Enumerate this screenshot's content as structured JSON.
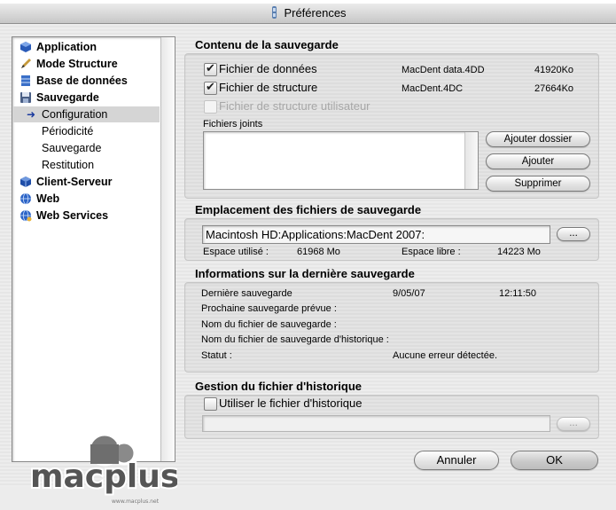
{
  "window": {
    "title": "Préférences"
  },
  "sidebar": {
    "items": [
      {
        "label": "Application",
        "icon": "app-cube-icon",
        "level": 0
      },
      {
        "label": "Mode Structure",
        "icon": "pencil-icon",
        "level": 0
      },
      {
        "label": "Base de données",
        "icon": "database-icon",
        "level": 0
      },
      {
        "label": "Sauvegarde",
        "icon": "floppy-icon",
        "level": 0
      },
      {
        "label": "Configuration",
        "icon": "arrow-right-icon",
        "level": 1,
        "selected": true
      },
      {
        "label": "Périodicité",
        "level": 1
      },
      {
        "label": "Sauvegarde",
        "level": 1
      },
      {
        "label": "Restitution",
        "level": 1
      },
      {
        "label": "Client-Serveur",
        "icon": "network-cube-icon",
        "level": 0
      },
      {
        "label": "Web",
        "icon": "globe-icon",
        "level": 0
      },
      {
        "label": "Web Services",
        "icon": "web-services-icon",
        "level": 0
      }
    ]
  },
  "backup_content": {
    "title": "Contenu de la sauvegarde",
    "files": [
      {
        "label": "Fichier de données",
        "checked": true,
        "disabled": false,
        "filename": "MacDent data.4DD",
        "size": "41920Ko"
      },
      {
        "label": "Fichier de structure",
        "checked": true,
        "disabled": false,
        "filename": "MacDent.4DC",
        "size": "27664Ko"
      },
      {
        "label": "Fichier de structure utilisateur",
        "checked": false,
        "disabled": true,
        "filename": "",
        "size": ""
      }
    ],
    "attached_label": "Fichiers joints",
    "buttons": {
      "add_folder": "Ajouter dossier",
      "add": "Ajouter",
      "remove": "Supprimer"
    }
  },
  "location": {
    "title": "Emplacement des fichiers de sauvegarde",
    "path": "Macintosh HD:Applications:MacDent 2007:",
    "browse": "...",
    "used_label": "Espace utilisé :",
    "used_value": "61968 Mo",
    "free_label": "Espace libre :",
    "free_value": "14223 Mo"
  },
  "last_backup": {
    "title": "Informations sur la dernière sauvegarde",
    "last_label": "Dernière sauvegarde",
    "last_date": "9/05/07",
    "last_time": "12:11:50",
    "next_label": "Prochaine sauvegarde prévue :",
    "name_label": "Nom du fichier de sauvegarde :",
    "log_name_label": "Nom du fichier de sauvegarde d'historique :",
    "status_label": "Statut :",
    "status_value": "Aucune erreur détectée."
  },
  "log": {
    "title": "Gestion du fichier d'historique",
    "use_label": "Utiliser le fichier d'historique",
    "checked": false,
    "browse": "..."
  },
  "footer": {
    "cancel": "Annuler",
    "ok": "OK"
  },
  "watermark": {
    "text": "macplus",
    "url": "www.macplus.net"
  }
}
